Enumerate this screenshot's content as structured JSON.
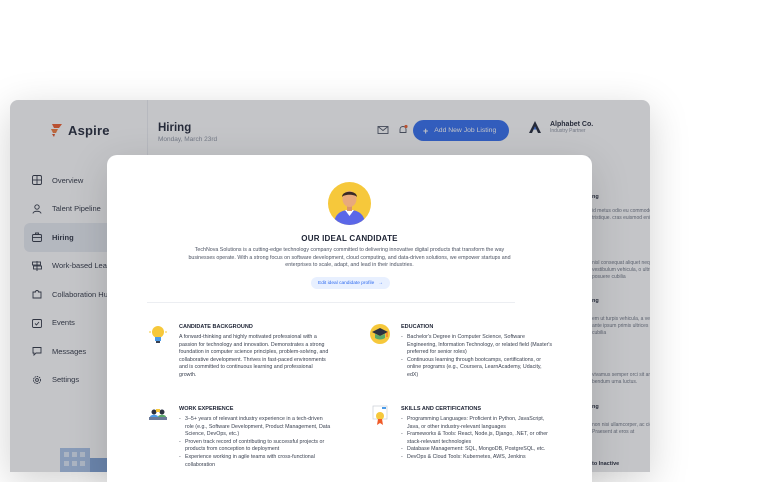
{
  "app": {
    "logo_text": "Aspire",
    "brand_color": "#f05a28",
    "nav": [
      {
        "label": "Overview",
        "icon": "grid-icon"
      },
      {
        "label": "Talent Pipeline",
        "icon": "person-icon"
      },
      {
        "label": "Hiring",
        "icon": "briefcase-icon",
        "active": true
      },
      {
        "label": "Work-based Learning",
        "icon": "signpost-icon"
      },
      {
        "label": "Collaboration Hub",
        "icon": "puzzle-icon"
      },
      {
        "label": "Events",
        "icon": "calendar-icon"
      },
      {
        "label": "Messages",
        "icon": "chat-icon"
      },
      {
        "label": "Settings",
        "icon": "gear-icon"
      }
    ],
    "header": {
      "title": "Hiring",
      "subtitle": "Monday, March 23rd",
      "add_button": "Add New Job Listing",
      "accent": "#2f6bf0"
    },
    "company": {
      "name": "Alphabet Co.",
      "role": "Industry Partner"
    },
    "right_column": {
      "items": [
        {
          "title": "ng",
          "text": "id metus odio eu commodo tristique. cras euismod enim"
        },
        {
          "title": "",
          "text": "nisl consequat aliquet neque. ulla a vestibulum vehicula, o ultrices posuere cubilia"
        },
        {
          "title": "ng",
          "text": "em ut turpis vehicula, a vestibulum ante ipsum primis ultrices posuere cubilia"
        },
        {
          "title": "",
          "text": "vivamus semper orci sit amet bendum urna luctus."
        },
        {
          "title": "ng",
          "text": "non nisi ullamcorper, ac cidunt. Praesent at eros at"
        },
        {
          "title": "to Inactive",
          "text": ""
        }
      ]
    }
  },
  "modal": {
    "title": "OUR IDEAL CANDIDATE",
    "description": "TechNova Solutions is a cutting-edge technology company committed to delivering innovative digital products that transform the way businesses operate. With a strong focus on software development, cloud computing, and data-driven solutions, we empower startups and enterprises to scale, adapt, and lead in their industries.",
    "edit_link": "Edit ideal candidate profile",
    "sections": {
      "background": {
        "title": "CANDIDATE BACKGROUND",
        "icon": "lightbulb-icon",
        "text": "A forward-thinking and highly motivated professional with a passion for technology and innovation. Demonstrates a strong foundation in computer science principles, problem-solving, and collaborative development. Thrives in fast-paced environments and is committed to continuous learning and professional growth."
      },
      "education": {
        "title": "EDUCATION",
        "icon": "graduation-cap-icon",
        "items": [
          "Bachelor's Degree in Computer Science, Software Engineering, Information Technology, or related field (Master's preferred for senior roles)",
          "Continuous learning through bootcamps, certifications, or online programs (e.g., Coursera, LearnAcademy, Udacity, edX)"
        ]
      },
      "experience": {
        "title": "WORK EXPERIENCE",
        "icon": "team-meeting-icon",
        "items": [
          "3–5+ years of relevant industry experience in a tech-driven role (e.g., Software Development, Product Management, Data Science, DevOps, etc.)",
          "Proven track record of contributing to successful projects or products from conception to deployment",
          "Experience working in agile teams with cross-functional collaboration"
        ]
      },
      "skills": {
        "title": "SKILLS AND CERTIFICATIONS",
        "icon": "certificate-icon",
        "items": [
          "Programming Languages: Proficient in Python, JavaScript, Java, or other industry-relevant languages",
          "Frameworks & Tools: React, Node.js, Django, .NET, or other stack-relevant technologies",
          "Database Management: SQL, MongoDB, PostgreSQL, etc.",
          "DevOps & Cloud Tools: Kubernetes, AWS, Jenkins"
        ]
      }
    }
  }
}
